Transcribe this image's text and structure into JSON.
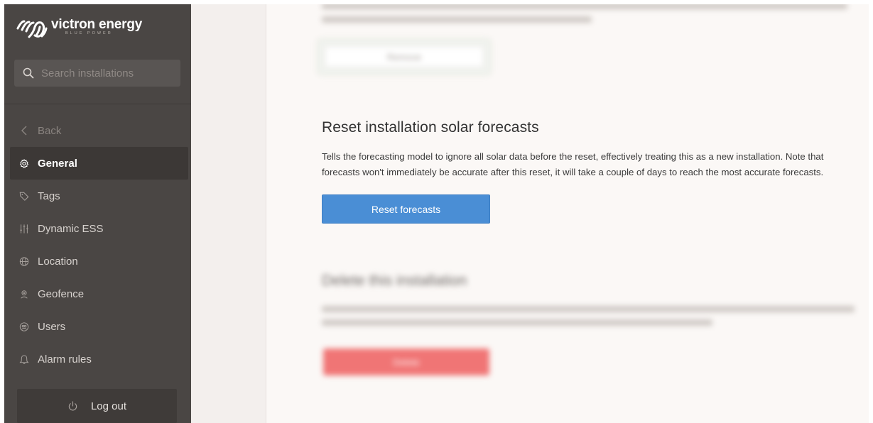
{
  "brand": {
    "name": "victron energy",
    "tagline": "BLUE POWER"
  },
  "search": {
    "placeholder": "Search installations",
    "value": ""
  },
  "nav": {
    "back": "Back",
    "items": [
      {
        "label": "General",
        "icon": "gear-icon",
        "active": true
      },
      {
        "label": "Tags",
        "icon": "tag-icon"
      },
      {
        "label": "Dynamic ESS",
        "icon": "sliders-icon"
      },
      {
        "label": "Location",
        "icon": "globe-icon"
      },
      {
        "label": "Geofence",
        "icon": "geofence-icon"
      },
      {
        "label": "Users",
        "icon": "users-icon"
      },
      {
        "label": "Alarm rules",
        "icon": "bell-icon"
      }
    ],
    "logout": "Log out"
  },
  "content": {
    "remove_button": "Remove",
    "reset_section": {
      "title": "Reset installation solar forecasts",
      "description": "Tells the forecasting model to ignore all solar data before the reset, effectively treating this as a new installation. Note that forecasts won't immediately be accurate after this reset, it will take a couple of days to reach the most accurate forecasts.",
      "button": "Reset forecasts"
    },
    "delete_section": {
      "title": "Delete this installation",
      "button": "Delete"
    }
  },
  "colors": {
    "sidebar": "#4a4644",
    "accent_blue": "#4a8ed5",
    "danger": "#f07575"
  }
}
